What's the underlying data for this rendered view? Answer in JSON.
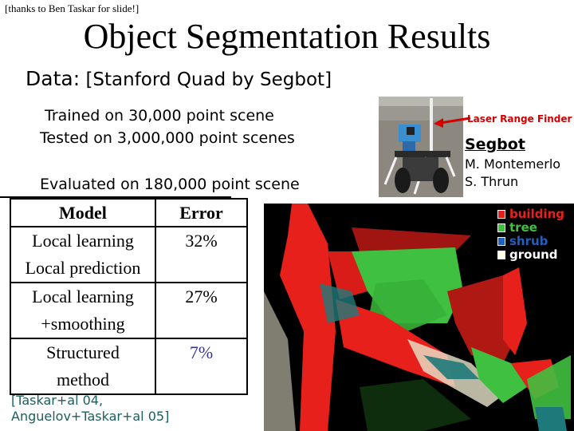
{
  "credit": "[thanks to Ben Taskar for slide!]",
  "title": "Object Segmentation Results",
  "data_label": "Data:",
  "data_value": "[Stanford Quad by Segbot]",
  "bullets": {
    "trained": "Trained on 30,000 point scene",
    "tested": "Tested on 3,000,000 point scenes",
    "evaluated": "Evaluated on 180,000 point scene"
  },
  "table": {
    "headers": [
      "Model",
      "Error"
    ],
    "rows": [
      {
        "model_line1": "Local learning",
        "model_line2": "Local prediction",
        "error": "32%"
      },
      {
        "model_line1": "Local learning",
        "model_line2": "+smoothing",
        "error": "27%"
      },
      {
        "model_line1": "Structured",
        "model_line2": "method",
        "error": "7%"
      }
    ]
  },
  "citation": {
    "line1": "[Taskar+al 04,",
    "line2": "Anguelov+Taskar+al 05]"
  },
  "robot": {
    "sensor_label": "Laser Range Finder",
    "name": "Segbot",
    "authors": [
      "M. Montemerlo",
      "S. Thrun"
    ]
  },
  "legend": [
    {
      "label": "building",
      "color": "#e8201c"
    },
    {
      "label": "tree",
      "color": "#40c040"
    },
    {
      "label": "shrub",
      "color": "#2060c0"
    },
    {
      "label": "ground",
      "color": "#ffffe8"
    }
  ]
}
